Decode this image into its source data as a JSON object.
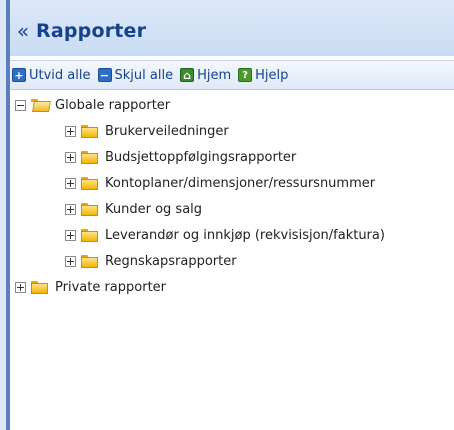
{
  "panel": {
    "collapse_glyph": "«",
    "title": "Rapporter"
  },
  "toolbar": {
    "expand_all": "Utvid alle",
    "collapse_all": "Skjul alle",
    "home": "Hjem",
    "help": "Hjelp"
  },
  "tree": {
    "global": {
      "label": "Globale rapporter",
      "children": [
        "Brukerveiledninger",
        "Budsjettoppfølgingsrapporter",
        "Kontoplaner/dimensjoner/ressursnummer",
        "Kunder og salg",
        "Leverandør og innkjøp (rekvisisjon/faktura)",
        "Regnskapsrapporter"
      ]
    },
    "private": {
      "label": "Private rapporter"
    }
  }
}
